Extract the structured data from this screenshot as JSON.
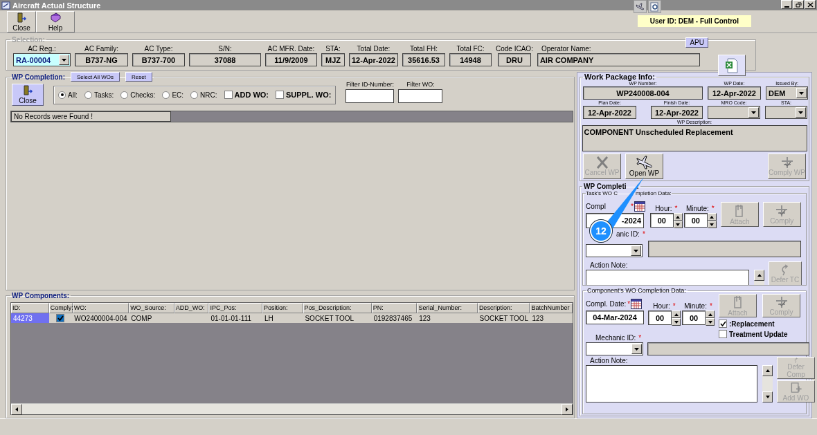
{
  "window": {
    "title": "Aircraft Actual Structure"
  },
  "toolbar": [
    {
      "label": "Close",
      "kind": "close"
    },
    {
      "label": "Help",
      "kind": "help"
    }
  ],
  "user_badge": "User ID: DEM - Full Control",
  "selection": {
    "title": "Selection:",
    "apu": "APU",
    "fields": [
      {
        "label": "AC Reg.:",
        "value": "RA-00004",
        "kind": "combo"
      },
      {
        "label": "AC Family:",
        "value": "B737-NG",
        "kind": "text"
      },
      {
        "label": "AC Type:",
        "value": "B737-700",
        "kind": "text"
      },
      {
        "label": "S/N:",
        "value": "37088",
        "kind": "text"
      },
      {
        "label": "AC MFR. Date:",
        "value": "11/9/2009",
        "kind": "text"
      },
      {
        "label": "STA:",
        "value": "MJZ",
        "kind": "text"
      },
      {
        "label": "Total Date:",
        "value": "12-Apr-2022",
        "kind": "text"
      },
      {
        "label": "Total FH:",
        "value": "35616.53",
        "kind": "text"
      },
      {
        "label": "Total FC:",
        "value": "14948",
        "kind": "text"
      },
      {
        "label": "Code ICAO:",
        "value": "DRU",
        "kind": "text"
      },
      {
        "label": "Operator Name:",
        "value": "AIR COMPANY",
        "kind": "wide"
      }
    ]
  },
  "wp_completion": {
    "title": "WP Completion:",
    "select_all": "Select All WOs",
    "reset": "Reset",
    "close": "Close",
    "radios": [
      {
        "label": "All:",
        "selected": true
      },
      {
        "label": "Tasks:",
        "selected": false
      },
      {
        "label": "Checks:",
        "selected": false
      },
      {
        "label": "EC:",
        "selected": false
      },
      {
        "label": "NRC:",
        "selected": false
      }
    ],
    "checks": [
      {
        "label": "ADD WO:",
        "checked": false
      },
      {
        "label": "SUPPL. WO:",
        "checked": false
      }
    ],
    "filter_id_label": "Filter ID-Number:",
    "filter_wo_label": "Filter WO:",
    "message": "No Records were Found !"
  },
  "wp_components": {
    "title": "WP Components:",
    "columns": [
      "ID:",
      "Comply:",
      "WO:",
      "WO_Source:",
      "ADD_WO:",
      "IPC_Pos:",
      "Position:",
      "Pos_Description:",
      "PN:",
      "Serial_Number:",
      "Description:",
      "BatchNumber"
    ],
    "rows": [
      {
        "selected": true,
        "id": "44273",
        "comply": true,
        "wo": "WO2400004-004",
        "wo_source": "COMP",
        "ipc_pos": "01-01-01-111",
        "position": "LH",
        "pos_description": "SOCKET TOOL",
        "pn": "0192837465",
        "serial_number": "123",
        "description": "SOCKET TOOL",
        "batch_number": "123"
      }
    ]
  },
  "work_package_info": {
    "title": "Work Package Info:",
    "wp_number": {
      "label": "WP Number:",
      "value": "WP240008-004"
    },
    "wp_date": {
      "label": "WP Date:",
      "value": "12-Apr-2022"
    },
    "issued_by": {
      "label": "Issued By:",
      "value": "DEM"
    },
    "plan_date": {
      "label": "Plan Date:",
      "value": "12-Apr-2022"
    },
    "finish_date": {
      "label": "Finish Date:",
      "value": "12-Apr-2022"
    },
    "mro_code": {
      "label": "MRO Code:"
    },
    "sta": {
      "label": "STA:"
    },
    "description": {
      "label": "WP Description:",
      "value": "COMPONENT Unscheduled Replacement"
    },
    "buttons": [
      {
        "label": "Cancel WP",
        "kind": "cancel",
        "disabled": true
      },
      {
        "label": "Open WP",
        "kind": "open",
        "disabled": false
      },
      {
        "label": "Comply WP",
        "kind": "comply",
        "disabled": true
      }
    ]
  },
  "wp_completion_panel": {
    "title": "WP Completi",
    "title_end": ":",
    "task": {
      "title": "Task's WO C",
      "title_end": "mpletion Data:",
      "date_label": "Compl",
      "date_mark": "*",
      "date_value": "-2024",
      "hour_label": "Hour:",
      "hour_mark": "*",
      "hour": "00",
      "minute_label": "Minute:",
      "minute_mark": "*",
      "minute": "00",
      "mechanic_label": "anic ID:",
      "mechanic_mark": "*",
      "action_label": "Action Note:",
      "buttons": [
        {
          "label": "Attach",
          "kind": "attach",
          "disabled": true
        },
        {
          "label": "Comply",
          "kind": "comply",
          "disabled": true
        },
        {
          "label": "Defer TC",
          "kind": "defer",
          "disabled": true
        }
      ]
    },
    "component": {
      "title": "Component's WO Completion Data:",
      "date_label": "Compl. Date:",
      "date_mark": "*",
      "date_value": "04-Mar-2024",
      "hour_label": "Hour:",
      "hour_mark": "*",
      "hour": "00",
      "minute_label": "Minute:",
      "minute_mark": "*",
      "minute": "00",
      "mechanic_label": "Mechanic ID:",
      "mechanic_mark": "*",
      "action_label": "Action Note:",
      "checks": [
        {
          "label": ":Replacement",
          "checked": true
        },
        {
          "label": "Treatment Update",
          "checked": false
        }
      ],
      "buttons": [
        {
          "label": "Attach",
          "kind": "attach",
          "disabled": true
        },
        {
          "label": "Comply",
          "kind": "comply",
          "disabled": true
        },
        {
          "label": "Defer Comp",
          "kind": "defer",
          "disabled": true
        },
        {
          "label": "Add WO",
          "kind": "add",
          "disabled": true
        }
      ]
    }
  },
  "callout": {
    "label": "12"
  }
}
